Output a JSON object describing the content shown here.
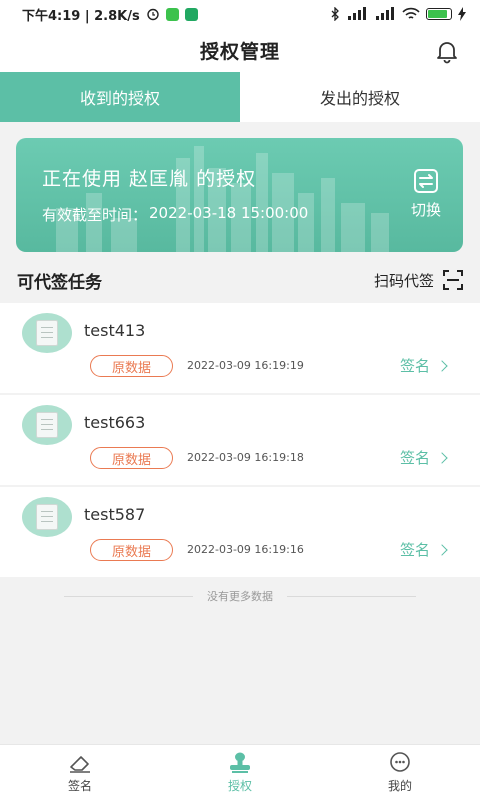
{
  "status_bar": {
    "time_speed": "下午4:19 | 2.8K/s",
    "battery_level": 0.8
  },
  "header": {
    "title": "授权管理"
  },
  "tabs": [
    {
      "label": "收到的授权",
      "active": true
    },
    {
      "label": "发出的授权",
      "active": false
    }
  ],
  "banner": {
    "title": "正在使用 赵匡胤 的授权",
    "expiry_label": "有效截至时间：",
    "expiry_value": "2022-03-18 15:00:00",
    "switch_label": "切换"
  },
  "section": {
    "title": "可代签任务",
    "scan_label": "扫码代签"
  },
  "tasks": [
    {
      "name": "test413",
      "badge": "原数据",
      "time": "2022-03-09 16:19:19",
      "action": "签名"
    },
    {
      "name": "test663",
      "badge": "原数据",
      "time": "2022-03-09 16:19:18",
      "action": "签名"
    },
    {
      "name": "test587",
      "badge": "原数据",
      "time": "2022-03-09 16:19:16",
      "action": "签名"
    }
  ],
  "list_footer": "没有更多数据",
  "bottom_nav": [
    {
      "label": "签名",
      "icon": "eraser-icon",
      "active": false
    },
    {
      "label": "授权",
      "icon": "stamp-icon",
      "active": true
    },
    {
      "label": "我的",
      "icon": "user-chat-icon",
      "active": false
    }
  ],
  "colors": {
    "accent": "#5cbfa6",
    "badge": "#ea7a52"
  }
}
